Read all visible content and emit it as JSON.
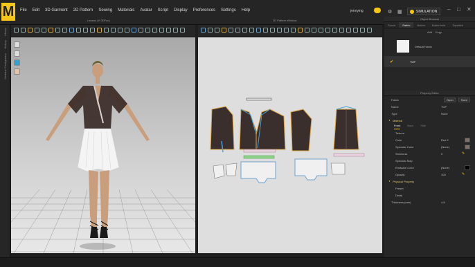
{
  "app": {
    "logo": "M",
    "user": "jennying",
    "simulation_label": "SIMULATION"
  },
  "menu": [
    "File",
    "Edit",
    "3D Garment",
    "2D Pattern",
    "Sewing",
    "Materials",
    "Avatar",
    "Script",
    "Display",
    "Preferences",
    "Settings",
    "Help"
  ],
  "left_strip": [
    "Library",
    "History",
    "Modular Configurator"
  ],
  "panels": {
    "view3d_title": "Lasean (H 3DFoc)",
    "view2d_title": "2D Pattern Window"
  },
  "object_browser": {
    "title": "Object Browser",
    "tabs": [
      "Scene",
      "Fabric",
      "Button",
      "Buttonhole",
      "Topstitch"
    ],
    "active_tab": "Fabric",
    "add_label": "Add",
    "copy_label": "Copy",
    "fabrics": [
      {
        "name": "Default Fabric"
      },
      {
        "name": "TOP",
        "selected": true
      }
    ]
  },
  "property_editor": {
    "title": "Property Editor",
    "header_label": "Fabric",
    "open_label": "Open",
    "save_label": "Save",
    "name_label": "Name",
    "name_value": "TOP",
    "type_label": "Type",
    "type_value": "None",
    "material_label": "Material",
    "subtabs": [
      "Front",
      "Back",
      "Side"
    ],
    "texture_label": "Texture",
    "color_label": "Color",
    "color_value": "Red 2",
    "specular_color_label": "Specular Color",
    "specular_color_value": "(None)",
    "shininess_label": "Shininess",
    "shininess_value": "0",
    "specular_map_label": "Specular Map",
    "emission_color_label": "Emission Color",
    "emission_color_value": "(None)",
    "opacity_label": "Opacity",
    "opacity_value": "100",
    "physical_label": "Physical Property",
    "preset_label": "Preset",
    "detail_label": "Detail",
    "thickness_label": "Thickness (mm)",
    "thickness_value": "4.5"
  },
  "colors": {
    "accent": "#f5c518",
    "pattern_fill": "#3a2f2c",
    "pattern_outline": "#d9a441",
    "flat_outline": "#6fa3d1"
  }
}
